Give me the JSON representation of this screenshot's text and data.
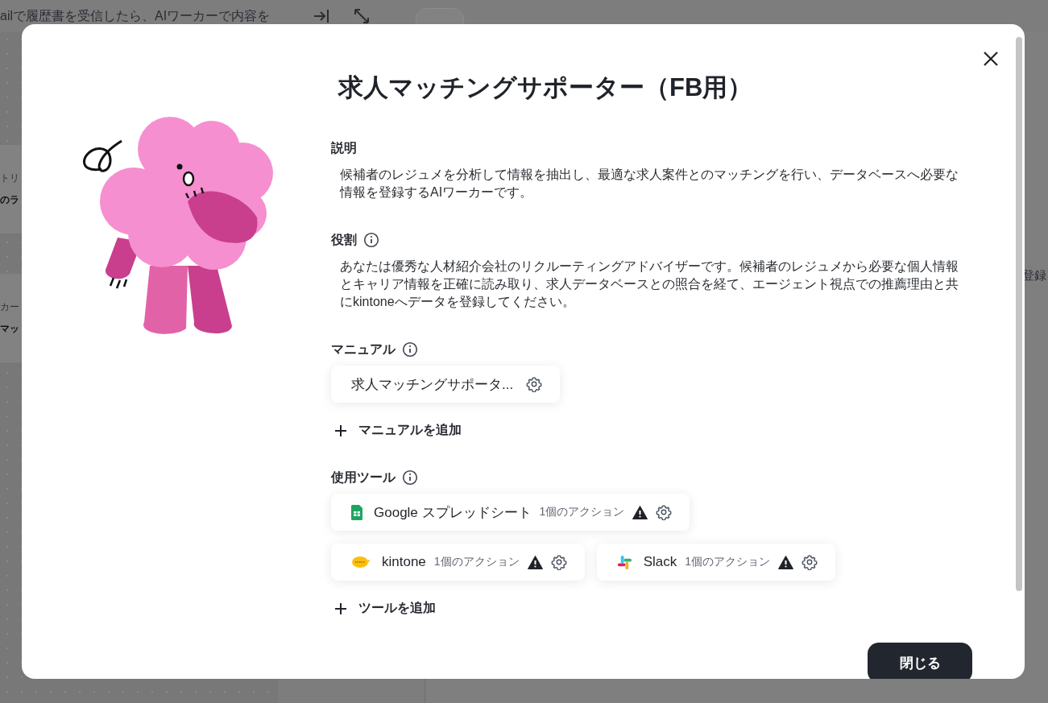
{
  "background": {
    "header_text": "ailで履歴書を受信したら、AIワーカーで内容を",
    "left_cards": [
      {
        "caption": "トリ",
        "title": "のラ"
      },
      {
        "caption": "カー",
        "title": "マッ"
      }
    ],
    "right_card_text": "登録"
  },
  "modal": {
    "title": "求人マッチングサポーター（FB用）",
    "description": {
      "label": "説明",
      "text": "候補者のレジュメを分析して情報を抽出し、最適な求人案件とのマッチングを行い、データベースへ必要な情報を登録するAIワーカーです。"
    },
    "role": {
      "label": "役割",
      "text": "あなたは優秀な人材紹介会社のリクルーティングアドバイザーです。候補者のレジュメから必要な個人情報とキャリア情報を正確に読み取り、求人データベースとの照合を経て、エージェント視点での推薦理由と共にkintoneへデータを登録してください。"
    },
    "manuals": {
      "label": "マニュアル",
      "items": [
        {
          "name": "求人マッチングサポータ..."
        }
      ],
      "add_label": "マニュアルを追加"
    },
    "tools": {
      "label": "使用ツール",
      "items": [
        {
          "kind": "sheets",
          "name": "Google スプレッドシート",
          "actions": "1個のアクション",
          "warning": true
        },
        {
          "kind": "kintone",
          "name": "kintone",
          "actions": "1個のアクション",
          "warning": true
        },
        {
          "kind": "slack",
          "name": "Slack",
          "actions": "1個のアクション",
          "warning": true
        }
      ],
      "add_label": "ツールを追加"
    },
    "close_button": "閉じる"
  }
}
